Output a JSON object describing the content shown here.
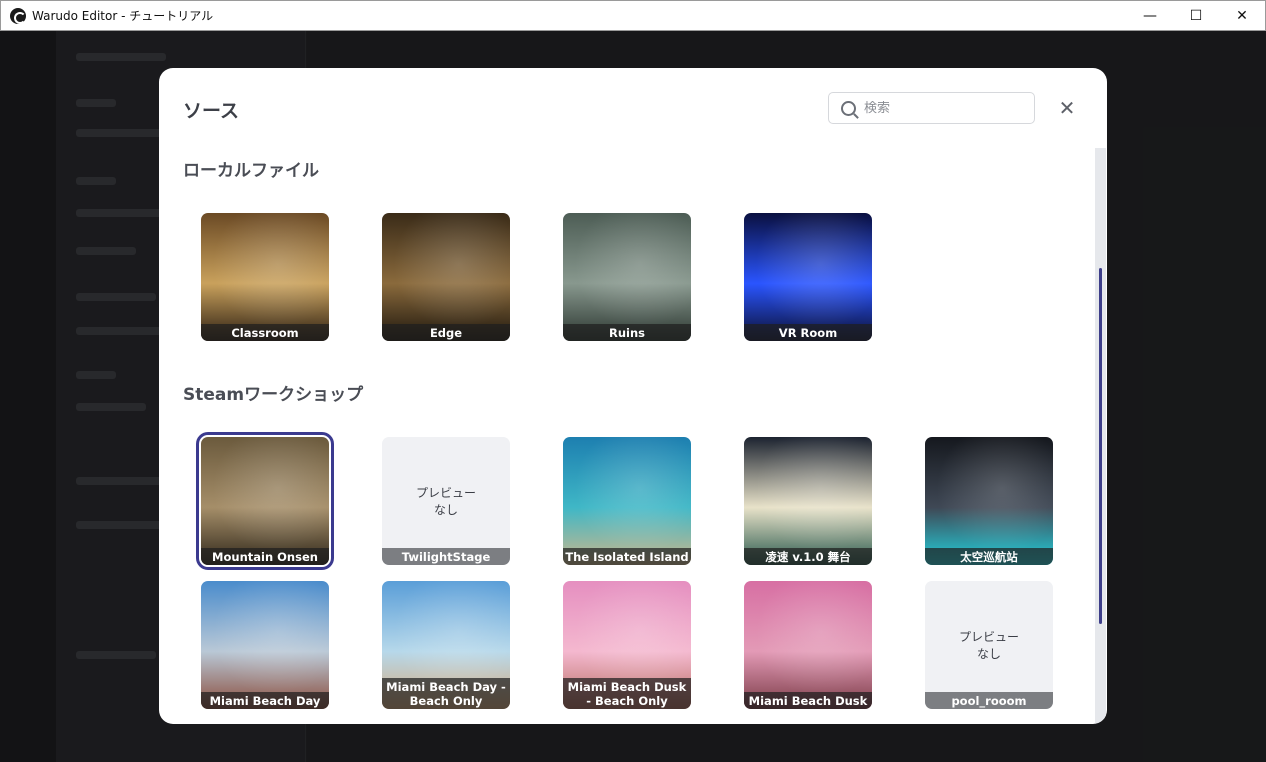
{
  "window": {
    "title": "Warudo Editor - チュートリアル",
    "minimize": "—",
    "maximize": "☐",
    "close": "✕"
  },
  "modal": {
    "title": "ソース",
    "search_placeholder": "検索",
    "close_icon": "✕"
  },
  "sections": {
    "local": "ローカルファイル",
    "steam": "Steamワークショップ"
  },
  "local_tiles": [
    {
      "label": "Classroom",
      "colors": [
        "#6b4a25",
        "#c9a15c",
        "#2b1e12"
      ]
    },
    {
      "label": "Edge",
      "colors": [
        "#3a2b18",
        "#8a6a3c",
        "#1d160d"
      ]
    },
    {
      "label": "Ruins",
      "colors": [
        "#4d5d55",
        "#88988e",
        "#2b3630"
      ]
    },
    {
      "label": "VR Room",
      "colors": [
        "#0a1040",
        "#2a55ff",
        "#0b0f30"
      ]
    }
  ],
  "steam_tiles": [
    {
      "label": "Mountain Onsen",
      "colors": [
        "#6b5a3d",
        "#a58e69",
        "#2f271a"
      ],
      "selected": true
    },
    {
      "label": "TwilightStage",
      "empty": true
    },
    {
      "label": "The Isolated Island",
      "colors": [
        "#1d7fb0",
        "#3fb7c6",
        "#cdb78b"
      ]
    },
    {
      "label": "凌速 v.1.0 舞台",
      "colors": [
        "#1c2330",
        "#e8e2c9",
        "#27574b"
      ]
    },
    {
      "label": "太空巡航站",
      "colors": [
        "#15181e",
        "#3f4855",
        "#22d4e0"
      ]
    },
    {
      "label": "Miami Beach Day",
      "colors": [
        "#4a8ccc",
        "#b9c8d6",
        "#8a4c3b"
      ]
    },
    {
      "label": "Miami Beach Day - Beach Only",
      "colors": [
        "#5a9ed8",
        "#b6d8ea",
        "#d8a878"
      ]
    },
    {
      "label": "Miami Beach Dusk - Beach Only",
      "colors": [
        "#e58fc0",
        "#f4b8cf",
        "#b56b5c"
      ]
    },
    {
      "label": "Miami Beach Dusk",
      "colors": [
        "#d76fa3",
        "#e39ab6",
        "#7a3b46"
      ]
    },
    {
      "label": "pool_rooom",
      "empty": true
    }
  ],
  "no_preview_text": "プレビュー\nなし"
}
